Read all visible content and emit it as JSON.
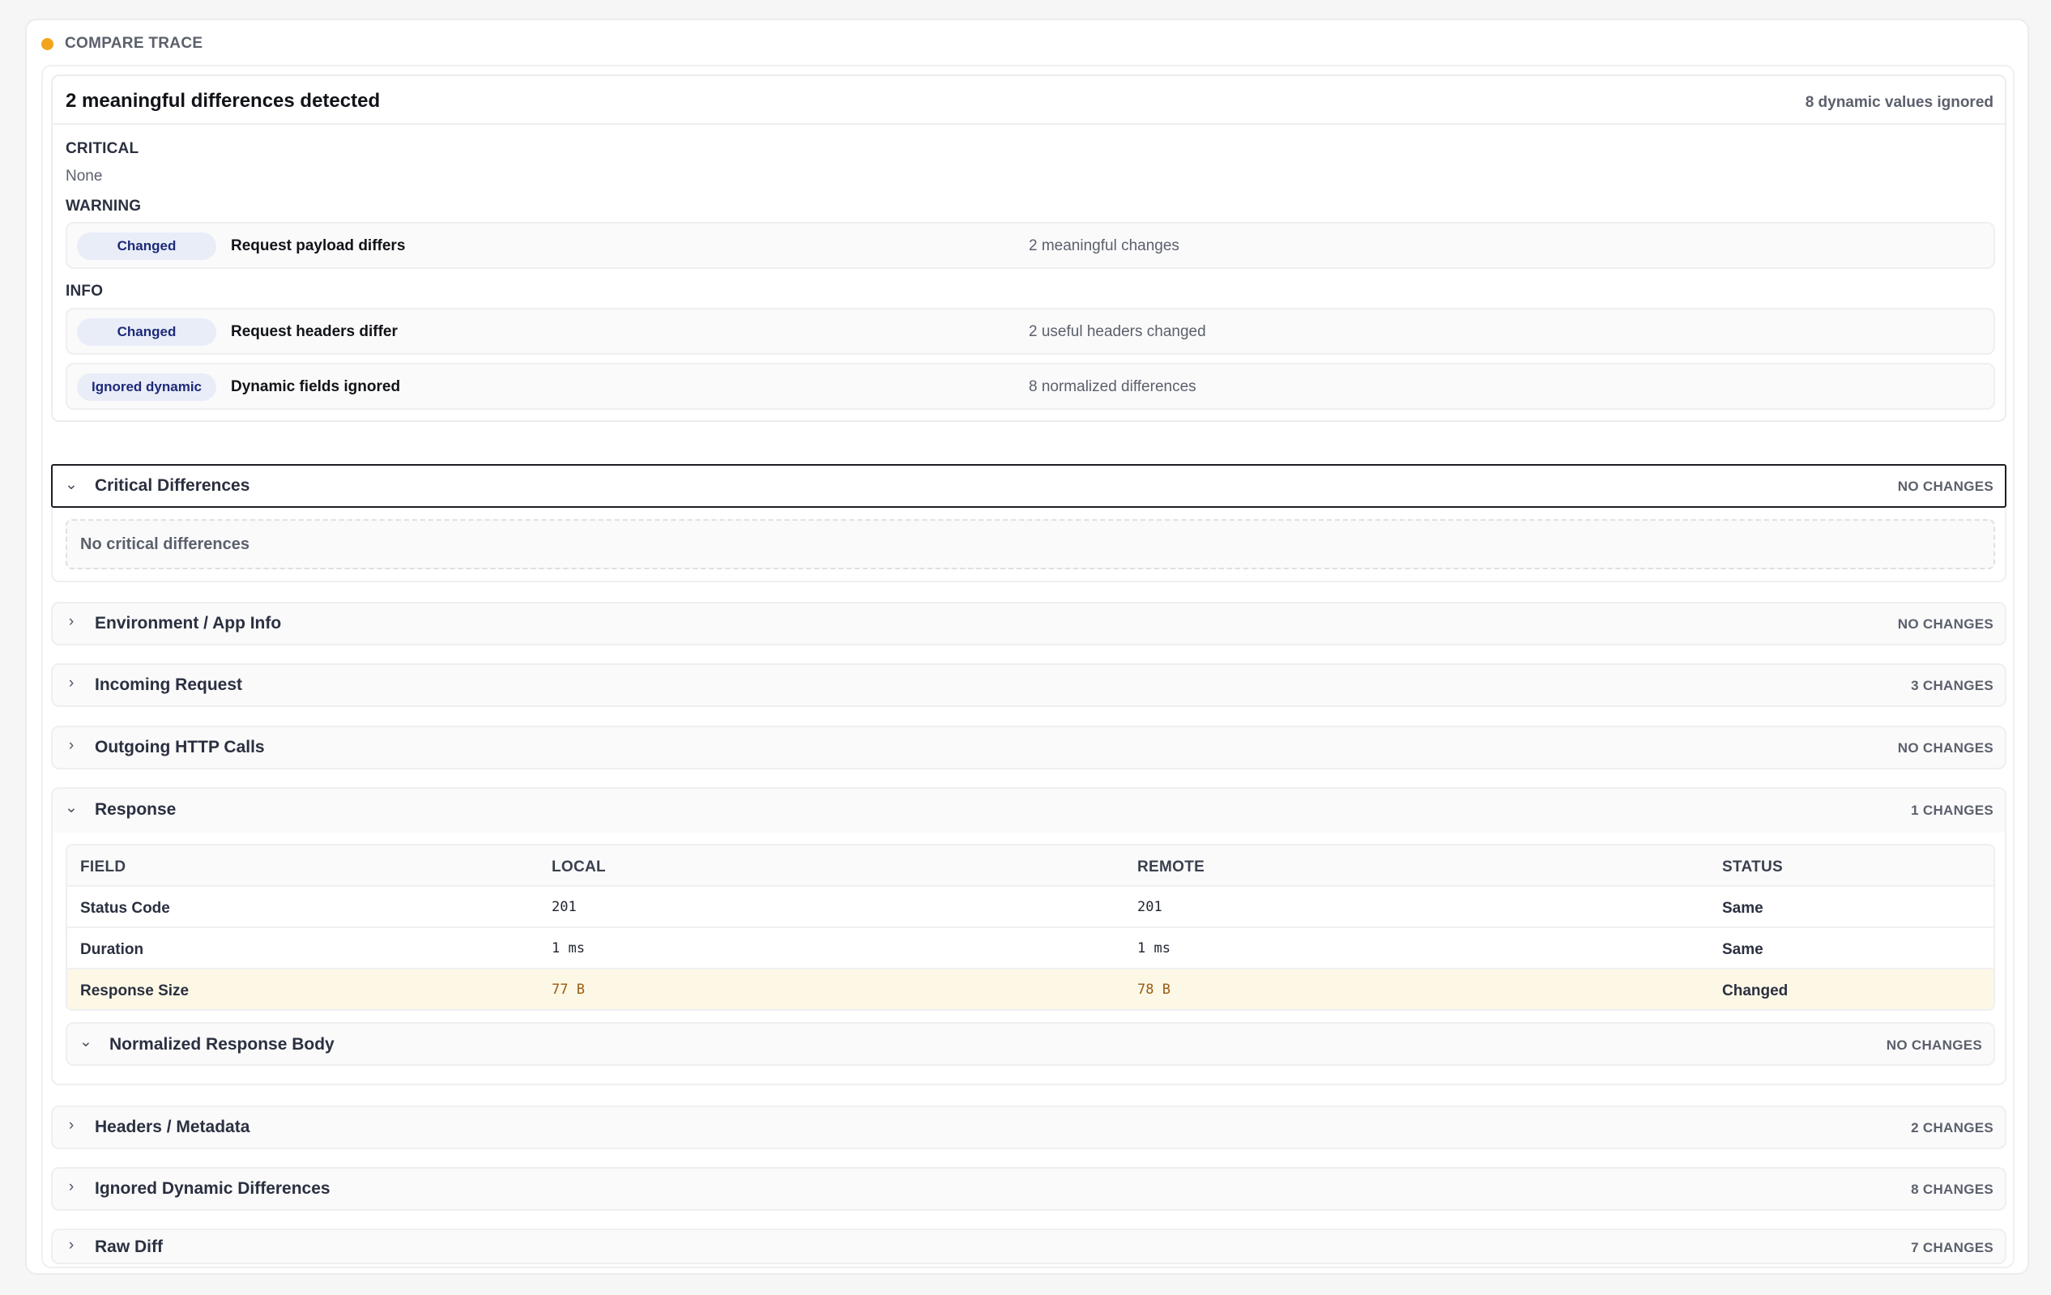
{
  "panel": {
    "title": "COMPARE TRACE",
    "status_color": "#f2a51c"
  },
  "summary": {
    "title": "2 meaningful differences detected",
    "ignored_note": "8 dynamic values ignored",
    "critical": {
      "label": "CRITICAL",
      "none_text": "None"
    },
    "warning": {
      "label": "WARNING",
      "items": [
        {
          "badge": "Changed",
          "title": "Request payload differs",
          "desc": "2 meaningful changes"
        }
      ]
    },
    "info": {
      "label": "INFO",
      "items": [
        {
          "badge": "Changed",
          "title": "Request headers differ",
          "desc": "2 useful headers changed"
        },
        {
          "badge": "Ignored dynamic",
          "title": "Dynamic fields ignored",
          "desc": "8 normalized differences"
        }
      ]
    }
  },
  "sections": {
    "critical": {
      "title": "Critical Differences",
      "count": "NO CHANGES",
      "empty_text": "No critical differences",
      "chevron": "⌄"
    },
    "environment": {
      "title": "Environment / App Info",
      "count": "NO CHANGES",
      "chevron": "›"
    },
    "incoming": {
      "title": "Incoming Request",
      "count": "3 CHANGES",
      "chevron": "›"
    },
    "outgoing": {
      "title": "Outgoing HTTP Calls",
      "count": "NO CHANGES",
      "chevron": "›"
    },
    "response": {
      "title": "Response",
      "count": "1 CHANGES",
      "chevron": "⌄",
      "table": {
        "headers": [
          "FIELD",
          "LOCAL",
          "REMOTE",
          "STATUS"
        ],
        "rows": [
          {
            "field": "Status Code",
            "local": "201",
            "remote": "201",
            "status": "Same"
          },
          {
            "field": "Duration",
            "local": "1 ms",
            "remote": "1 ms",
            "status": "Same"
          },
          {
            "field": "Response Size",
            "local": "77 B",
            "remote": "78 B",
            "status": "Changed"
          }
        ]
      },
      "normalized_body": {
        "title": "Normalized Response Body",
        "count": "NO CHANGES",
        "chevron": "⌄"
      }
    },
    "headers": {
      "title": "Headers / Metadata",
      "count": "2 CHANGES",
      "chevron": "›"
    },
    "ignored": {
      "title": "Ignored Dynamic Differences",
      "count": "8 CHANGES",
      "chevron": "›"
    },
    "raw": {
      "title": "Raw Diff",
      "count": "7 CHANGES",
      "chevron": "›"
    }
  }
}
